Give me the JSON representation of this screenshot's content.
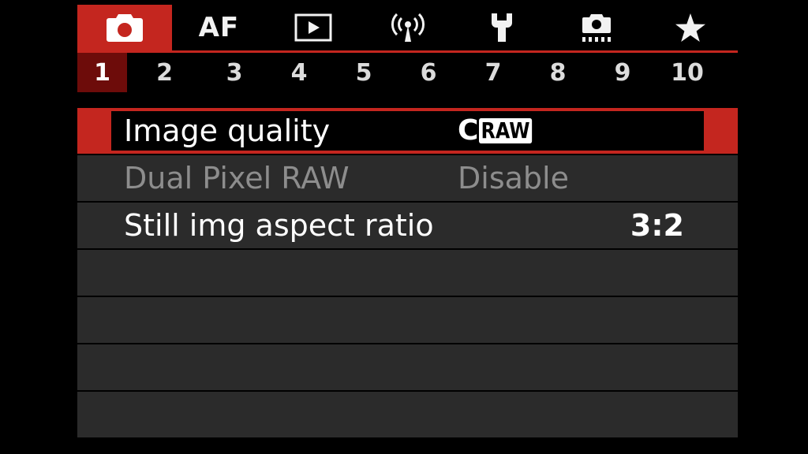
{
  "tabs": [
    {
      "id": "shooting",
      "icon": "camera-icon",
      "active": true
    },
    {
      "id": "af",
      "label": "AF"
    },
    {
      "id": "playback",
      "icon": "play-icon"
    },
    {
      "id": "wireless",
      "icon": "wireless-icon"
    },
    {
      "id": "setup",
      "icon": "wrench-icon"
    },
    {
      "id": "custom",
      "icon": "custom-camera-icon"
    },
    {
      "id": "mymenu",
      "icon": "star-icon"
    }
  ],
  "pages": [
    "1",
    "2",
    "3",
    "4",
    "5",
    "6",
    "7",
    "8",
    "9",
    "10"
  ],
  "active_page": "1",
  "menu": {
    "items": [
      {
        "label": "Image quality",
        "value_prefix": "C",
        "value_box": "RAW",
        "selected": true
      },
      {
        "label": "Dual Pixel RAW",
        "value": "Disable",
        "disabled": true
      },
      {
        "label": "Still img aspect ratio",
        "value": "3:2"
      }
    ]
  },
  "colors": {
    "accent": "#c4261f",
    "page_active": "#6d0c0a",
    "row_bg": "#2b2b2b",
    "disabled_text": "#8d8d8d"
  }
}
